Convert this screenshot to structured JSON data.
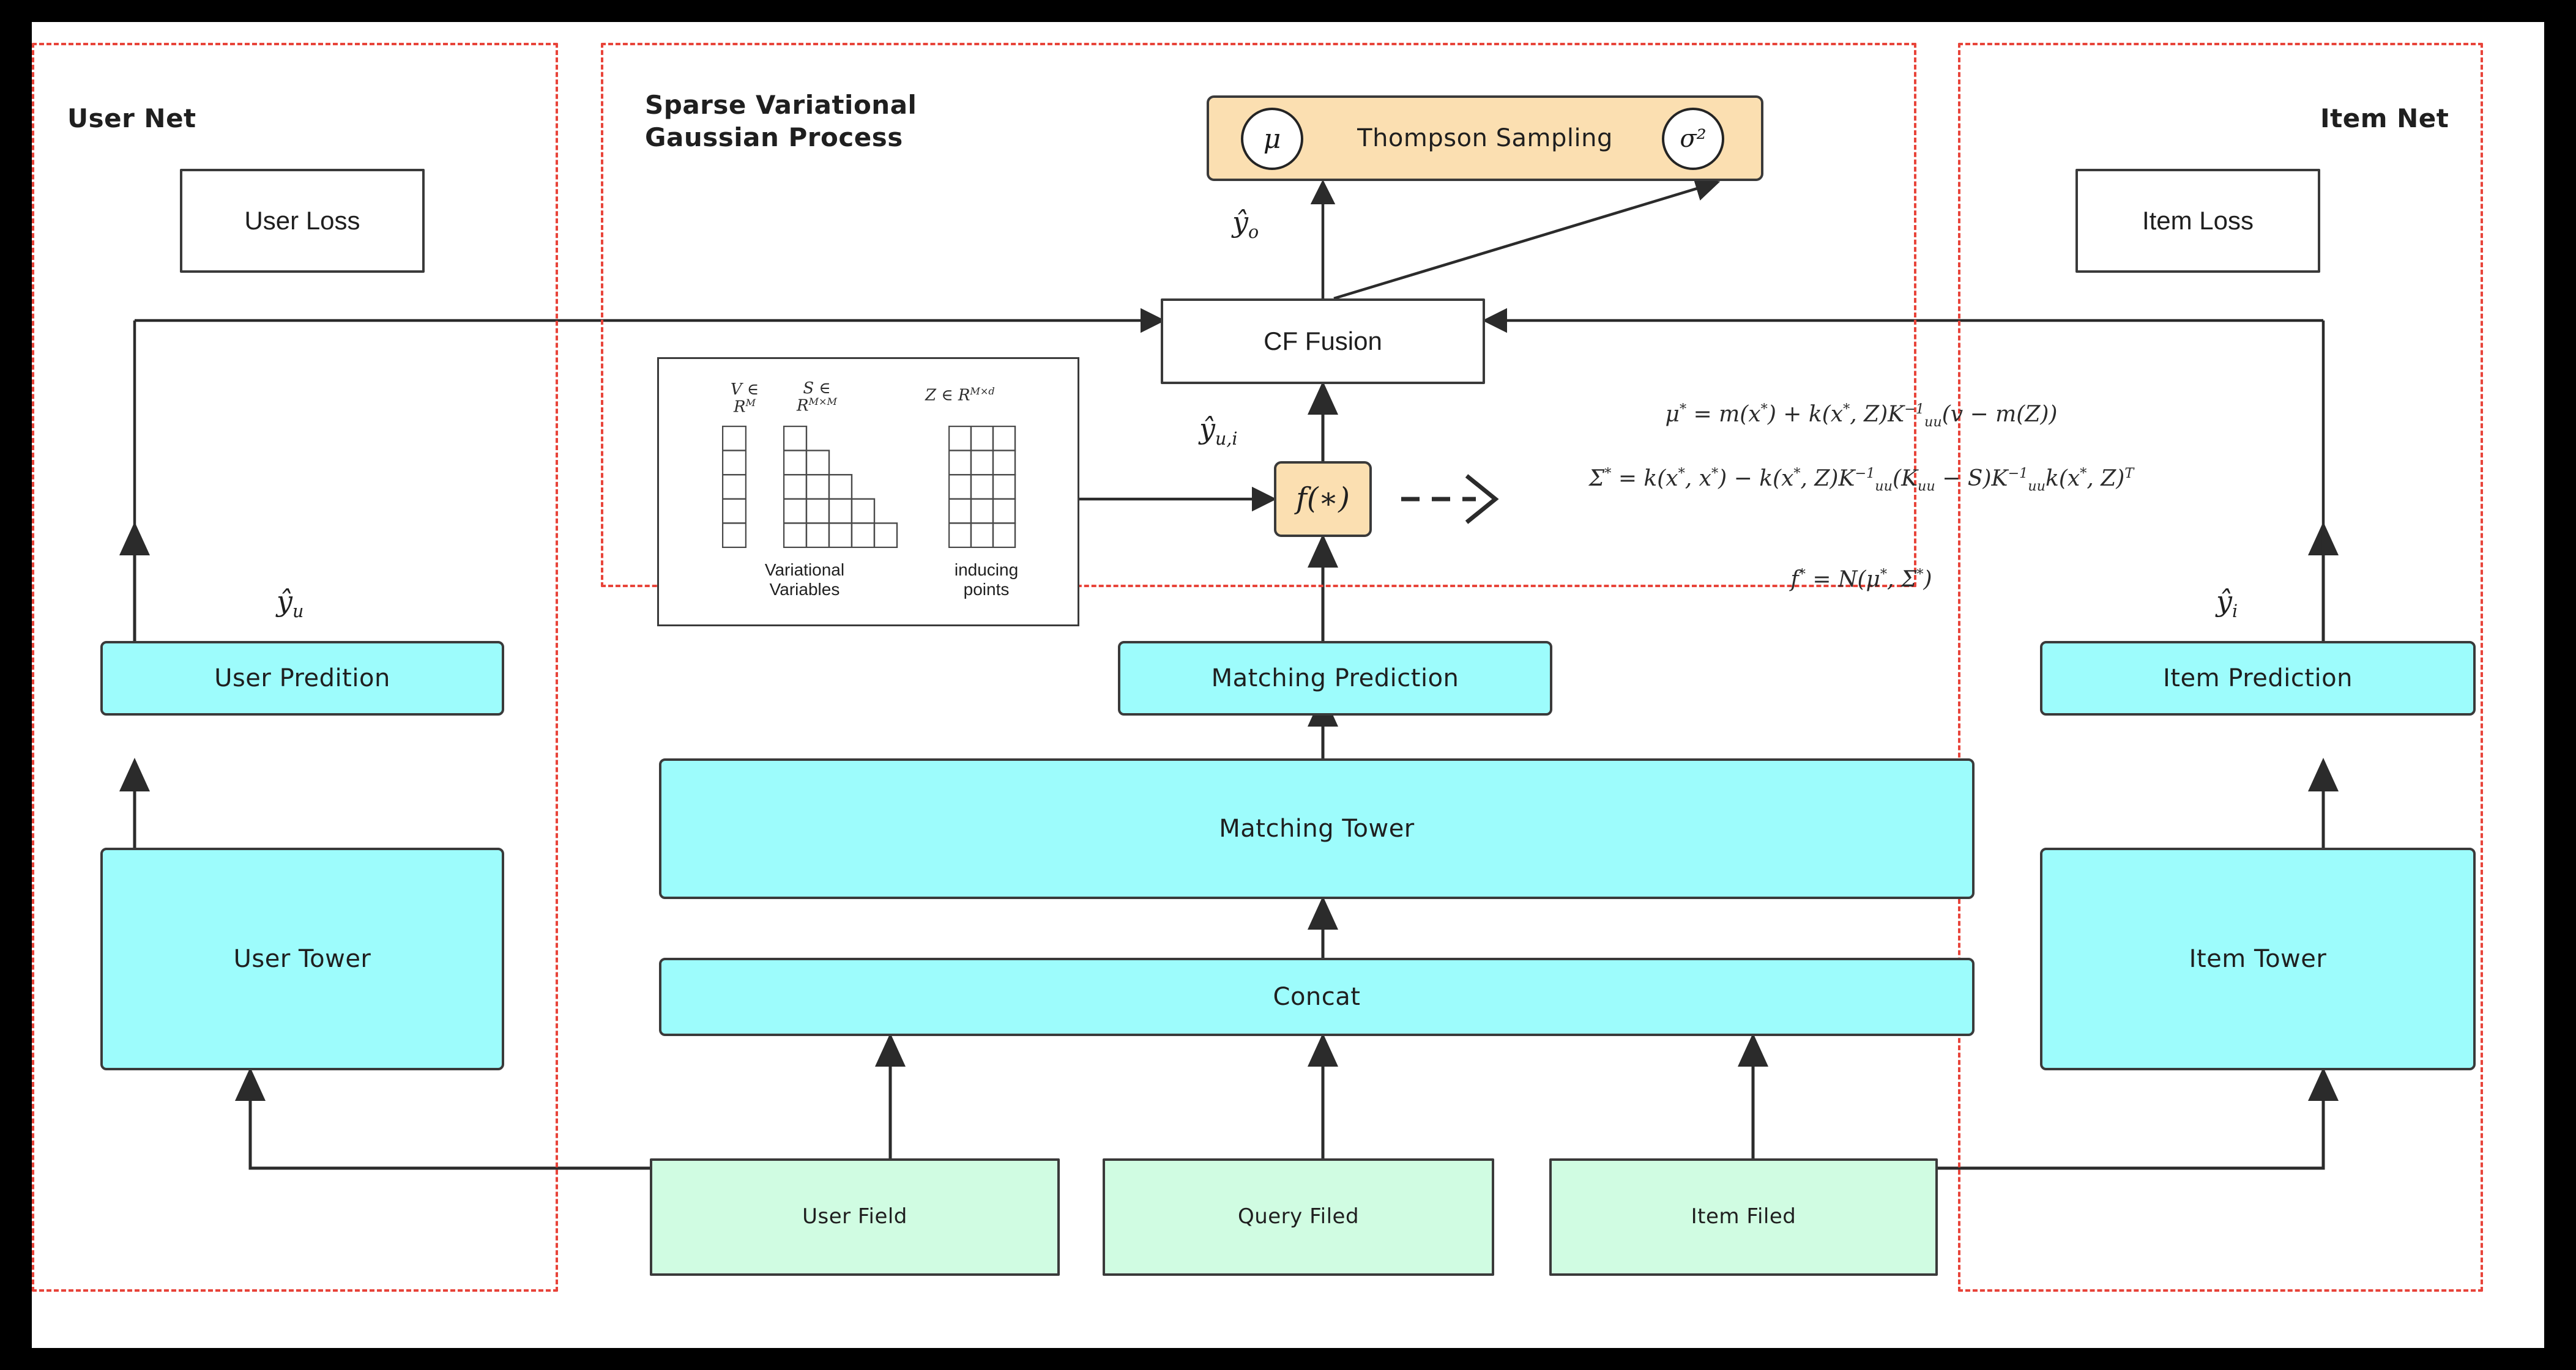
{
  "colors": {
    "background": "#000000",
    "canvas": "#ffffff",
    "group_border": "#E8443A",
    "node_border": "#3a3a3a",
    "cyan_fill": "#9DFCFC",
    "green_fill": "#D0FCE2",
    "orange_fill": "#FBDFB1",
    "white_fill": "#ffffff",
    "text": "#1f1f1f"
  },
  "groups": {
    "user_net": {
      "label": "User Net"
    },
    "svgp": {
      "label": "Sparse Variational\nGaussian Process"
    },
    "item_net": {
      "label": "Item Net"
    }
  },
  "nodes": {
    "user_loss": {
      "label": "User Loss"
    },
    "user_prediction": {
      "label": "User Predition"
    },
    "user_tower": {
      "label": "User Tower"
    },
    "user_field": {
      "label": "User Field"
    },
    "item_loss": {
      "label": "Item Loss"
    },
    "item_prediction": {
      "label": "Item Prediction"
    },
    "item_tower": {
      "label": "Item Tower"
    },
    "item_field": {
      "label": "Item Filed"
    },
    "matching_prediction": {
      "label": "Matching Prediction"
    },
    "matching_tower": {
      "label": "Matching Tower"
    },
    "concat": {
      "label": "Concat"
    },
    "query_field": {
      "label": "Query Filed"
    },
    "cf_fusion": {
      "label": "CF Fusion"
    },
    "thompson_sampling": {
      "label": "Thompson Sampling"
    },
    "f_star": {
      "label": "f(∗)"
    },
    "mu_circle": {
      "label": "μ"
    },
    "sigma_circle": {
      "label": "σ²"
    }
  },
  "edge_labels": {
    "y_hat_u": "ŷ",
    "y_hat_u_sub": "u",
    "y_hat_i": "ŷ",
    "y_hat_i_sub": "i",
    "y_hat_o": "ŷ",
    "y_hat_o_sub": "o",
    "y_hat_ui": "ŷ",
    "y_hat_ui_sub": "u,i"
  },
  "svgp_panel": {
    "matrices": [
      {
        "name": "V",
        "membership": "V ∈\nR",
        "exponent": "M",
        "caption": "Variational\nVariables",
        "shape": "column",
        "rows": 5,
        "cols": 1
      },
      {
        "name": "S",
        "membership": "S ∈\nR",
        "exponent": "M×M",
        "caption": "",
        "shape": "lower-triangular",
        "rows": 5,
        "cols": 5
      },
      {
        "name": "Z",
        "membership": "Z ∈ R",
        "exponent": "M×d",
        "caption": "inducing\npoints",
        "shape": "grid",
        "rows": 5,
        "cols": 3
      }
    ]
  },
  "formulas": [
    {
      "id": "mu_star",
      "text": "μ* = m(x*) + k(x*, Z)K⁻¹ᵤᵤ(v − m(Z))"
    },
    {
      "id": "sigma_star",
      "text": "Σ* = k(x*, x*) − k(x*, Z)K⁻¹ᵤᵤ(Kᵤᵤ − S)K⁻¹ᵤᵤk(x*, Z)ᵀ"
    },
    {
      "id": "f_star",
      "text": "f* = N(μ*, Σ*)"
    }
  ],
  "formula_parts": {
    "mu_line": [
      "μ",
      "*",
      " = m(x",
      "*",
      ") + k(x",
      "*",
      ", Z)K",
      "-1",
      "uu",
      "(v − m(Z))"
    ],
    "sigma_l1": [
      "Σ",
      "*",
      " = k(x",
      "*",
      ", x",
      "*",
      ") − k(x",
      "*",
      ", Z)K",
      "-1",
      "uu",
      "(K",
      "uu",
      " −"
    ],
    "sigma_l2": [
      "S)K",
      "-1",
      "uu",
      "k(x",
      "*",
      ", Z)",
      "T"
    ],
    "f_line": [
      "f",
      "*",
      " = N(μ",
      "*",
      ", Σ",
      "*",
      ")"
    ]
  }
}
